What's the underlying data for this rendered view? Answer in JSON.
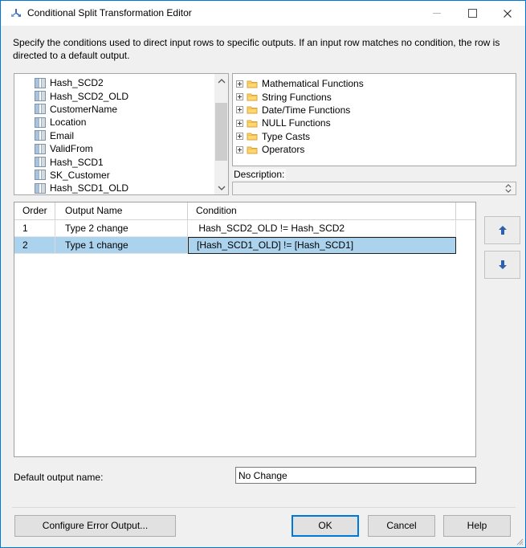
{
  "window": {
    "title": "Conditional Split Transformation Editor",
    "description": "Specify the conditions used to direct input rows to specific outputs. If an input row matches no condition, the row is directed to a default output."
  },
  "columns_tree": {
    "items": [
      "Hash_SCD2",
      "Hash_SCD2_OLD",
      "CustomerName",
      "Location",
      "Email",
      "ValidFrom",
      "Hash_SCD1",
      "SK_Customer",
      "Hash_SCD1_OLD"
    ]
  },
  "functions_tree": {
    "items": [
      "Mathematical Functions",
      "String Functions",
      "Date/Time Functions",
      "NULL Functions",
      "Type Casts",
      "Operators"
    ]
  },
  "description_field": {
    "label": "Description:",
    "value": ""
  },
  "grid": {
    "columns": {
      "order": "Order",
      "output_name": "Output Name",
      "condition": "Condition"
    },
    "rows": [
      {
        "order": "1",
        "output_name": "Type 2 change",
        "condition": " Hash_SCD2_OLD != Hash_SCD2",
        "selected": false
      },
      {
        "order": "2",
        "output_name": "Type 1 change",
        "condition": "[Hash_SCD1_OLD] != [Hash_SCD1]",
        "selected": true
      }
    ]
  },
  "default_output": {
    "label": "Default output name:",
    "value": "No Change"
  },
  "buttons": {
    "configure_error_output": "Configure Error Output...",
    "ok": "OK",
    "cancel": "Cancel",
    "help": "Help"
  },
  "icons": {
    "app": "conditional-split",
    "minimize": "–",
    "maximize": "□",
    "close": "✕",
    "tree_expand": "+",
    "folder": "folder",
    "column": "column",
    "move_up": "arrow-up",
    "move_down": "arrow-down"
  },
  "colors": {
    "accent": "#0078d7",
    "selection": "#abd3ee",
    "titlebar": "#ffffff",
    "dialog_bg": "#f0f0f0",
    "folder": "#ffd671",
    "arrow_blue": "#2e5fae"
  }
}
